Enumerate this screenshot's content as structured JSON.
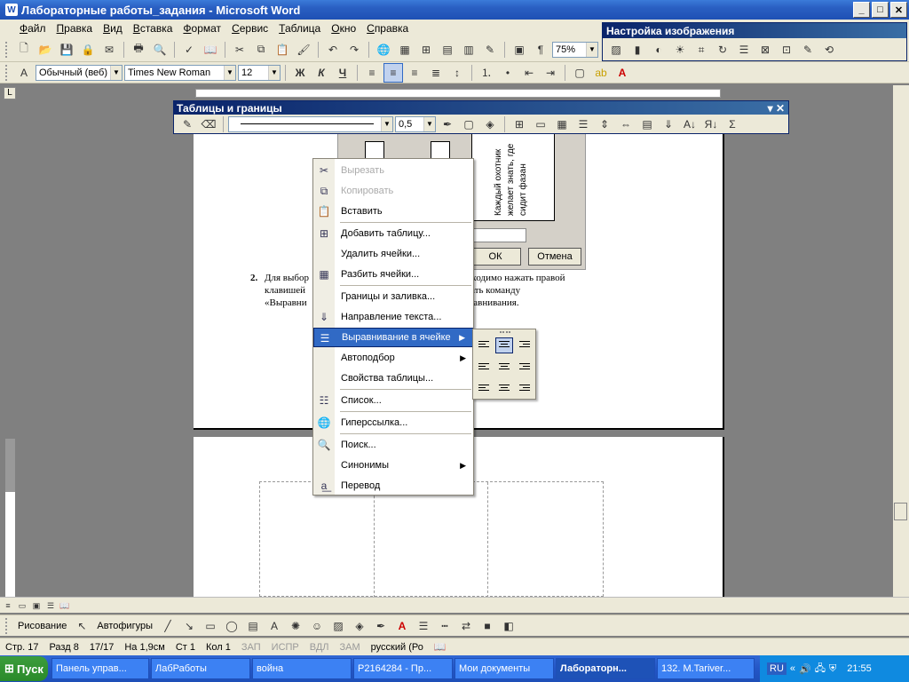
{
  "window": {
    "title": "Лабораторные работы_задания - Microsoft Word",
    "buttons": [
      "_",
      "□",
      "✕"
    ]
  },
  "menubar": {
    "items": [
      "Файл",
      "Правка",
      "Вид",
      "Вставка",
      "Формат",
      "Сервис",
      "Таблица",
      "Окно",
      "Справка"
    ]
  },
  "toolbar_standard": {
    "zoom": "75%"
  },
  "toolbar_format": {
    "style": "Обычный (веб)",
    "font": "Times New Roman",
    "size": "12",
    "bold": "Ж",
    "italic": "К",
    "underline": "Ч"
  },
  "image_toolbar": {
    "title": "Настройка изображения"
  },
  "tables_toolbar": {
    "title": "Таблицы и границы",
    "line_width": "0,5"
  },
  "document": {
    "item_number": "2.",
    "paragraph_line1": "Для выбор                              ячейке таблицы, необходимо нажать правой",
    "paragraph_line2": "клавишей                              нтекстном меню выбрать команду",
    "paragraph_line3": "«Выравни                              з девяти способов выравнивания.",
    "dialog_ok": "ОК",
    "dialog_cancel": "Отмена",
    "dialog_sample_text": "Каждый охотник желает знать, где сидит фазан"
  },
  "context_menu": {
    "items": [
      {
        "label": "Вырезать",
        "icon": "scissors-icon",
        "disabled": true
      },
      {
        "label": "Копировать",
        "icon": "copy-icon",
        "disabled": true
      },
      {
        "label": "Вставить",
        "icon": "paste-icon"
      },
      {
        "label": "Добавить таблицу...",
        "icon": "table-icon"
      },
      {
        "label": "Удалить ячейки...",
        "icon": ""
      },
      {
        "label": "Разбить ячейки...",
        "icon": "split-cells-icon"
      },
      {
        "label": "Границы и заливка...",
        "icon": ""
      },
      {
        "label": "Направление текста...",
        "icon": "text-direction-icon"
      },
      {
        "label": "Выравнивание в ячейке",
        "icon": "align-icon",
        "submenu": true,
        "selected": true
      },
      {
        "label": "Автоподбор",
        "icon": "",
        "submenu": true
      },
      {
        "label": "Свойства таблицы...",
        "icon": ""
      },
      {
        "label": "Список...",
        "icon": "list-icon"
      },
      {
        "label": "Гиперссылка...",
        "icon": "hyperlink-icon"
      },
      {
        "label": "Поиск...",
        "icon": "search-icon"
      },
      {
        "label": "Синонимы",
        "icon": "",
        "submenu": true
      },
      {
        "label": "Перевод",
        "icon": "translate-icon"
      }
    ]
  },
  "status": {
    "page": "Стр. 17",
    "section": "Разд 8",
    "pages": "17/17",
    "at": "На 1,9см",
    "line": "Ст 1",
    "col": "Кол 1",
    "rec": "ЗАП",
    "trk": "ИСПР",
    "ext": "ВДЛ",
    "ovr": "ЗАМ",
    "lang": "русский (Ро"
  },
  "drawing_toolbar": {
    "draw": "Рисование",
    "autoshapes": "Автофигуры"
  },
  "taskbar": {
    "start": "Пуск",
    "tasks": [
      "Панель управ...",
      "ЛабРаботы",
      "война",
      "P2164284 - Пр...",
      "Мои документы",
      "Лабораторн...",
      "132. M.Tariver..."
    ],
    "lang": "RU",
    "time": "21:55"
  }
}
